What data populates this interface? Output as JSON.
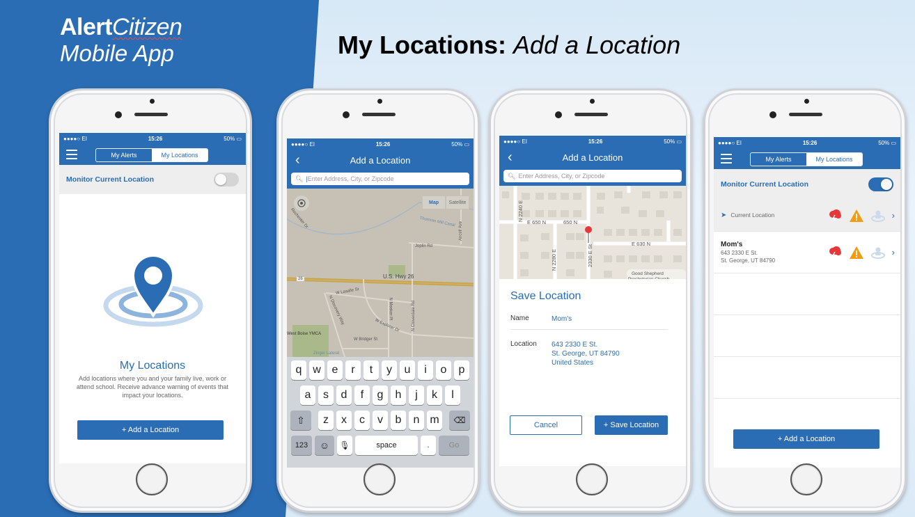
{
  "brand": {
    "alert": "Alert",
    "citizen": "Citizen",
    "subtitle": "Mobile App"
  },
  "slide": {
    "title_bold": "My Locations:",
    "title_italic": "Add a Location"
  },
  "colors": {
    "brand_blue": "#2a6db4",
    "storm_red": "#e8363a",
    "warning_orange": "#f39c12"
  },
  "status_bar": {
    "carrier": "●●●●○ EI",
    "time": "15:26",
    "battery": "50%"
  },
  "phone1": {
    "tabs": [
      "My Alerts",
      "My Locations"
    ],
    "active_tab": "My Locations",
    "monitor_label": "Monitor Current Location",
    "monitor_on": false,
    "empty_title": "My Locations",
    "empty_desc": "Add locations where you and your family live, work or attend school. Receive advance warning of events that impact your locations.",
    "add_button": "+ Add a Location"
  },
  "phone2": {
    "title": "Add a Location",
    "search_placeholder": "Enter Address, City, or Zipcode",
    "map_toggle": [
      "Map",
      "Satellite"
    ],
    "map_labels": [
      "Thurman Mill Canal",
      "Joplin Rd",
      "U.S. Hwy 26",
      "W Lasalle St",
      "N Discovery Way",
      "N Meeker Pl",
      "N Cloverdale Rd",
      "W Explorer Dr",
      "West Boise YMCA",
      "W Bridger St",
      "Zinger Lateral",
      "Ancell Ave",
      "Rochester Dr",
      "26"
    ],
    "keyboard": {
      "row1": [
        "q",
        "w",
        "e",
        "r",
        "t",
        "y",
        "u",
        "i",
        "o",
        "p"
      ],
      "row2": [
        "a",
        "s",
        "d",
        "f",
        "g",
        "h",
        "j",
        "k",
        "l"
      ],
      "row3": [
        "z",
        "x",
        "c",
        "v",
        "b",
        "n",
        "m"
      ],
      "numbers": "123",
      "space": "space",
      "period": ".",
      "go": "Go"
    }
  },
  "phone3": {
    "title": "Add a Location",
    "search_placeholder": "Enter Address, City, or Zipcode",
    "map_labels": [
      "N 2240 E",
      "E 650 N",
      "650 N",
      "E 630 N",
      "N 2280 E",
      "2330 E St",
      "Good Shepherd",
      "Presbyterian Church"
    ],
    "save_title": "Save Location",
    "name_label": "Name",
    "name_value": "Mom's",
    "location_label": "Location",
    "location_lines": [
      "643 2330 E St.",
      "St. George, UT  84790",
      "United States"
    ],
    "cancel": "Cancel",
    "save": "+ Save Location"
  },
  "phone4": {
    "tabs": [
      "My Alerts",
      "My Locations"
    ],
    "monitor_label": "Monitor Current Location",
    "monitor_on": true,
    "current_location": "Current Location",
    "saved": {
      "name": "Mom's",
      "addr1": "643 2330 E St.",
      "addr2": "St. George, UT 84790"
    },
    "add_button": "+ Add a Location"
  }
}
